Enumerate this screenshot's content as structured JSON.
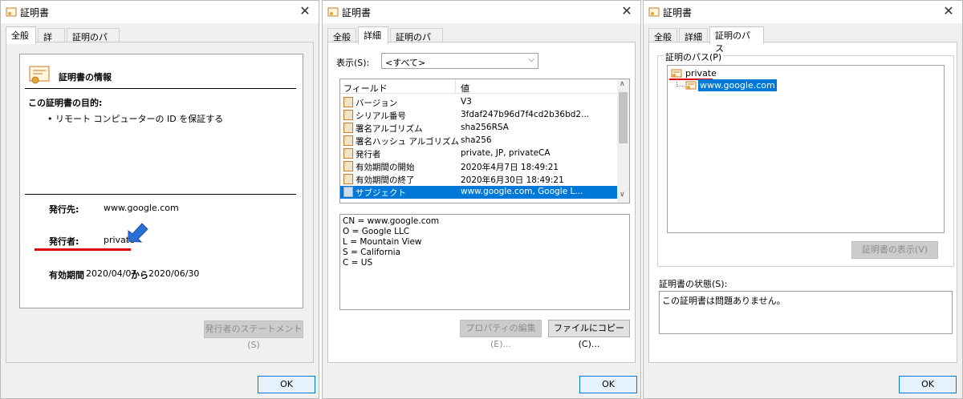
{
  "dialog1": {
    "title": "証明書",
    "tabs": [
      "全般",
      "詳細",
      "証明のパス"
    ],
    "info_heading": "証明書の情報",
    "purpose_heading": "この証明書の目的:",
    "purpose_item": "• リモート コンピューターの ID を保証する",
    "issued_to_label": "発行先:",
    "issued_to_value": "www.google.com",
    "issued_by_label": "発行者:",
    "issued_by_value": "private",
    "validity_label": "有効期間",
    "validity_from": "2020/04/07",
    "validity_kara": "から",
    "validity_to": "2020/06/30",
    "statement_button": "発行者のステートメント(S)",
    "ok_button": "OK"
  },
  "dialog2": {
    "title": "証明書",
    "tabs": [
      "全般",
      "詳細",
      "証明のパス"
    ],
    "show_label": "表示(S):",
    "show_value": "<すべて>",
    "col_field": "フィールド",
    "col_value": "値",
    "rows": [
      {
        "field": "バージョン",
        "value": "V3"
      },
      {
        "field": "シリアル番号",
        "value": "3fdaf247b96d7f4cd2b36bd2..."
      },
      {
        "field": "署名アルゴリズム",
        "value": "sha256RSA"
      },
      {
        "field": "署名ハッシュ アルゴリズム",
        "value": "sha256"
      },
      {
        "field": "発行者",
        "value": "private, JP, privateCA"
      },
      {
        "field": "有効期間の開始",
        "value": "2020年4月7日 18:49:21"
      },
      {
        "field": "有効期間の終了",
        "value": "2020年6月30日 18:49:21"
      },
      {
        "field": "サブジェクト",
        "value": "www.google.com, Google L..."
      }
    ],
    "detail_lines": [
      "CN = www.google.com",
      "O = Google LLC",
      "L = Mountain View",
      "S = California",
      "C = US"
    ],
    "edit_button": "プロパティの編集(E)...",
    "copy_button": "ファイルにコピー(C)...",
    "ok_button": "OK"
  },
  "dialog3": {
    "title": "証明書",
    "tabs": [
      "全般",
      "詳細",
      "証明のパス"
    ],
    "path_label": "証明のパス(P)",
    "path_root": "private",
    "path_leaf": "www.google.com",
    "view_button": "証明書の表示(V)",
    "status_label": "証明書の状態(S):",
    "status_text": "この証明書は問題ありません。",
    "ok_button": "OK"
  },
  "colors": {
    "accent": "#0078d7",
    "annotation_red": "#e00000",
    "annotation_arrow": "#2b6fd6"
  }
}
